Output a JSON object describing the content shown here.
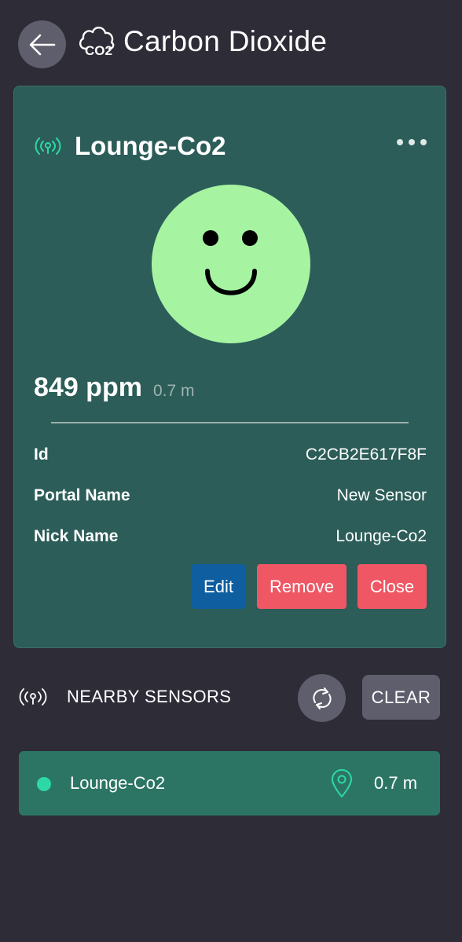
{
  "header": {
    "title": "Carbon Dioxide",
    "back_icon": "arrow-left-icon",
    "co2_icon": "co2-cloud-icon",
    "co2_icon_text": "CO2"
  },
  "sensor_card": {
    "title": "Lounge-Co2",
    "signal_icon": "broadcast-signal-icon",
    "more_icon": "more-horizontal-icon",
    "status_face": "happy-face-icon",
    "face_color": "#a6f4a2",
    "reading": "849 ppm",
    "distance": "0.7 m",
    "details": [
      {
        "label": "Id",
        "value": "C2CB2E617F8F"
      },
      {
        "label": "Portal Name",
        "value": "New Sensor"
      },
      {
        "label": "Nick Name",
        "value": "Lounge-Co2"
      }
    ],
    "buttons": {
      "edit": "Edit",
      "remove": "Remove",
      "close": "Close"
    }
  },
  "nearby": {
    "label": "NEARBY SENSORS",
    "icon": "broadcast-signal-icon",
    "refresh_icon": "refresh-icon",
    "clear_label": "CLEAR",
    "items": [
      {
        "name": "Lounge-Co2",
        "distance": "0.7 m",
        "status_color": "#2ed8a6",
        "pin_icon": "map-pin-icon"
      }
    ]
  },
  "colors": {
    "background": "#2d2c37",
    "card": "#2c5d58",
    "accent_green": "#2ed8a6",
    "edit_blue": "#0f5fa0",
    "danger_red": "#ef5765",
    "neutral_button": "#5f5e6c",
    "list_item": "#2c7565"
  }
}
